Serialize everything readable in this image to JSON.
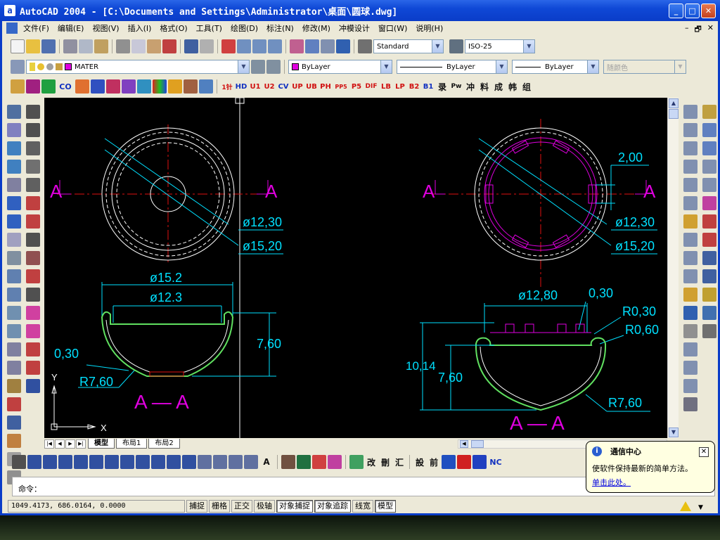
{
  "window": {
    "title": "AutoCAD 2004 - [C:\\Documents and Settings\\Administrator\\桌面\\圆球.dwg]",
    "app_icon": "a",
    "minimize": "_",
    "maximize": "□",
    "close": "✕"
  },
  "menu": [
    "文件(F)",
    "编辑(E)",
    "视图(V)",
    "插入(I)",
    "格式(O)",
    "工具(T)",
    "绘图(D)",
    "标注(N)",
    "修改(M)",
    "冲模设计",
    "窗口(W)",
    "说明(H)"
  ],
  "mdi_controls": [
    "–",
    "🗗",
    "✕"
  ],
  "styles": {
    "text_style": "Standard",
    "dim_style": "ISO-25"
  },
  "layers": {
    "current_layer": "MATER",
    "color": "ByLayer",
    "linetype": "ByLayer",
    "lineweight": "ByLayer",
    "plot_style": "随颜色"
  },
  "custom_toolbar": [
    "1针",
    "HD",
    "U1",
    "U2",
    "CV",
    "UP",
    "UB",
    "PH",
    "PP5",
    "P5",
    "DIF",
    "LB",
    "LP",
    "B2",
    "B1",
    "录",
    "Pw",
    "冲",
    "料",
    "成",
    "帏",
    "组"
  ],
  "draw_toolbar_glyphs": [
    "改",
    "刪",
    "汇",
    "設",
    "前",
    "NC"
  ],
  "drawing": {
    "left": {
      "section_label_a": "A",
      "section_label": "A — A",
      "dia_a": "ø12,30",
      "dia_b": "ø15,20",
      "top_dia_outer": "ø15.2",
      "top_dia_inner": "ø12.3",
      "height": "7,60",
      "thickness": "0,30",
      "radius": "R7,60"
    },
    "right": {
      "section_label_a": "A",
      "section_label": "A — A",
      "gap": "2,00",
      "dia_a": "ø12,30",
      "dia_b": "ø15,20",
      "top_dia": "ø12,80",
      "thickness": "0,30",
      "r_small": "R0,30",
      "r_mid": "R0,60",
      "height_total": "10,14",
      "height": "7,60",
      "radius": "R7,60"
    },
    "ucs_x": "X",
    "ucs_y": "Y"
  },
  "layout_tabs": [
    "模型",
    "布局1",
    "布局2"
  ],
  "command": {
    "prompt": "命令："
  },
  "status": {
    "coords": "1049.4173, 686.0164, 0.0000",
    "toggles": [
      "捕捉",
      "栅格",
      "正交",
      "极轴",
      "对象捕捉",
      "对象追踪",
      "线宽",
      "模型"
    ],
    "on": [
      false,
      false,
      false,
      false,
      true,
      true,
      false,
      true
    ]
  },
  "balloon": {
    "title": "通信中心",
    "body": "使软件保持最新的简单方法。",
    "link": "单击此处。",
    "close": "✕",
    "info": "i"
  },
  "colors": {
    "cad_cyan": "#00e0ff",
    "cad_magenta": "#e000e0",
    "cad_red": "#e01010",
    "cad_white": "#ffffff",
    "cad_green": "#60e060"
  }
}
